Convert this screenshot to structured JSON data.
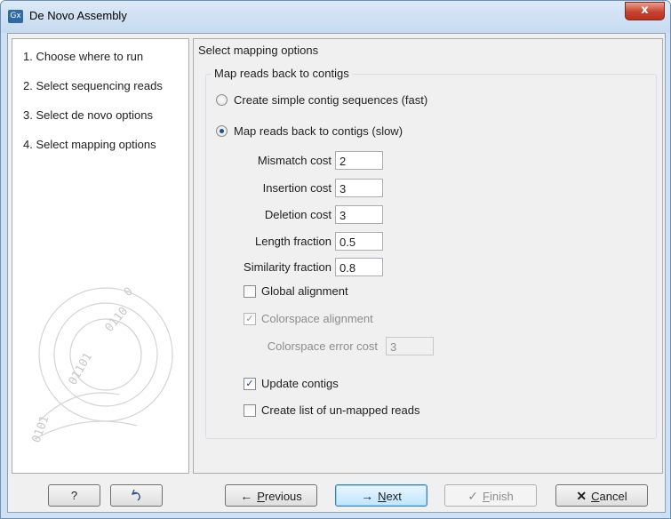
{
  "window": {
    "app_icon": "Gx",
    "title": "De Novo Assembly",
    "close_symbol": "x"
  },
  "steps": [
    {
      "label": "1.  Choose where to run"
    },
    {
      "label": "2.  Select sequencing reads"
    },
    {
      "label": "3.  Select de novo options"
    },
    {
      "label": "4.  Select mapping options"
    }
  ],
  "main": {
    "section_title": "Select mapping options",
    "group_title": "Map reads back to contigs",
    "radio_simple": "Create simple contig sequences (fast)",
    "radio_simple_selected": false,
    "radio_map": "Map reads back to contigs (slow)",
    "radio_map_selected": true,
    "fields": {
      "mismatch_label": "Mismatch cost",
      "mismatch_value": "2",
      "insertion_label": "Insertion cost",
      "insertion_value": "3",
      "deletion_label": "Deletion cost",
      "deletion_value": "3",
      "length_label": "Length fraction",
      "length_value": "0.5",
      "similarity_label": "Similarity fraction",
      "similarity_value": "0.8"
    },
    "global_alignment": {
      "label": "Global alignment",
      "checked": false
    },
    "colorspace_alignment": {
      "label": "Colorspace alignment",
      "checked": true,
      "disabled": true
    },
    "colorspace_error": {
      "label": "Colorspace error cost",
      "value": "3",
      "disabled": true
    },
    "update_contigs": {
      "label": "Update contigs",
      "checked": true
    },
    "unmapped_list": {
      "label": "Create list of un-mapped reads",
      "checked": false
    }
  },
  "buttons": {
    "help": "?",
    "reset_icon": "undo-icon",
    "previous_prefix": "",
    "previous_accel": "P",
    "previous_rest": "revious",
    "next_accel": "N",
    "next_rest": "ext",
    "finish_accel": "F",
    "finish_rest": "inish",
    "cancel_accel": "C",
    "cancel_rest": "ancel"
  },
  "colors": {
    "titlebar": "#c6daf0",
    "close_button": "#c8412e",
    "default_button": "#bee6fd"
  }
}
